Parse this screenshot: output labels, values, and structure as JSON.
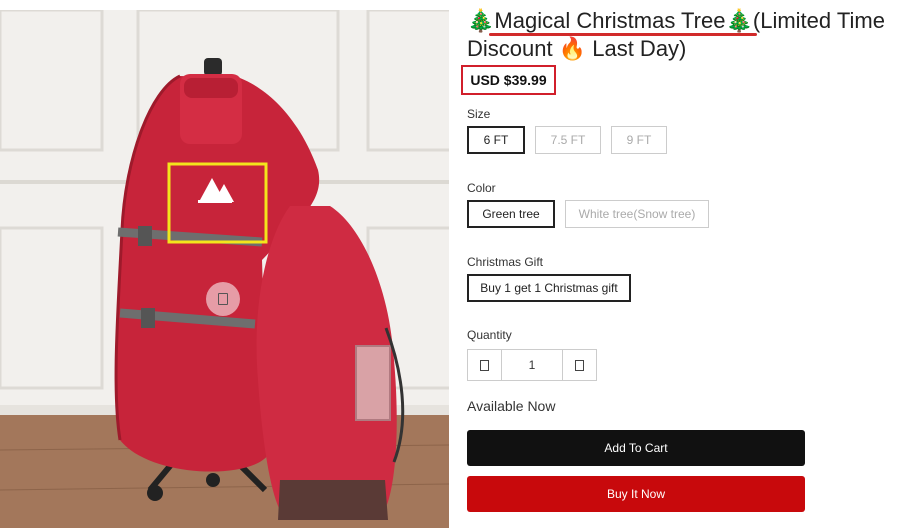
{
  "product": {
    "title_prefix_emoji": "🎄",
    "title_name": "Magical Christmas Tree",
    "title_mid_emoji": "🎄",
    "title_suffix": "(Limited Time Discount ",
    "title_fire_emoji": "🔥",
    "title_end": " Last Day)",
    "price": "USD $39.99",
    "image_alt": "Red Christmas tree storage bag with wheels",
    "image_nav_icon": "image-nav-icon"
  },
  "options": {
    "size": {
      "label": "Size",
      "choices": [
        "6 FT",
        "7.5 FT",
        "9 FT"
      ],
      "selected": "6 FT"
    },
    "color": {
      "label": "Color",
      "choices": [
        "Green tree",
        "White tree(Snow tree)"
      ],
      "selected": "Green tree"
    },
    "gift": {
      "label": "Christmas Gift",
      "choices": [
        "Buy 1 get 1 Christmas gift"
      ],
      "selected": "Buy 1 get 1 Christmas gift"
    }
  },
  "quantity": {
    "label": "Quantity",
    "value": "1",
    "minus_icon": "minus-icon",
    "plus_icon": "plus-icon"
  },
  "availability": "Available Now",
  "actions": {
    "add_to_cart": "Add To Cart",
    "buy_now": "Buy It Now"
  },
  "colors": {
    "highlight_red": "#d11f2b",
    "highlight_yellow": "#f3e51c",
    "bag_red": "#c7243a",
    "buy_now_bg": "#c8090c",
    "cart_bg": "#111111"
  }
}
